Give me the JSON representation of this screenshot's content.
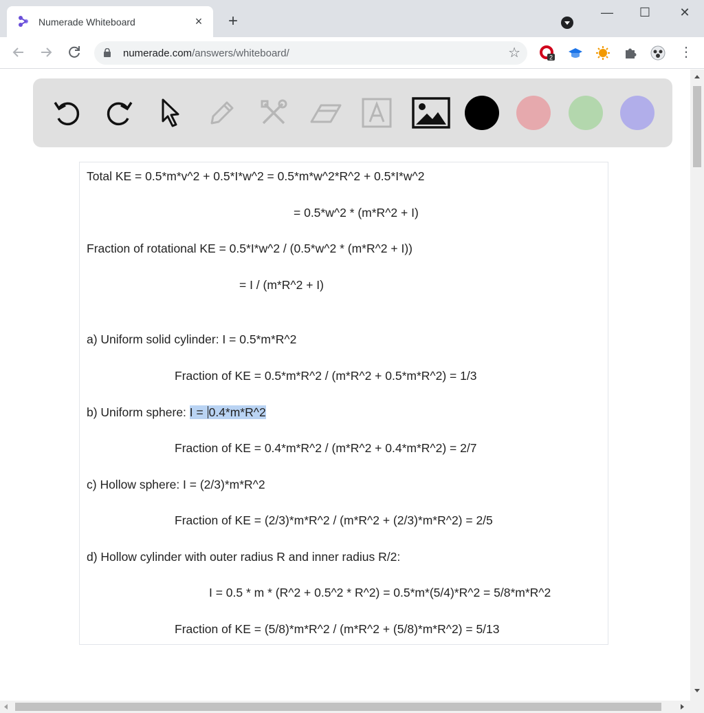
{
  "browser": {
    "tab_title": "Numerade Whiteboard",
    "tab_close": "×",
    "new_tab": "+",
    "url_domain": "numerade.com",
    "url_path": "/answers/whiteboard/",
    "ext_badge": "2",
    "window_minimize": "—",
    "window_maximize": "☐",
    "window_close": "✕"
  },
  "whiteboard_tools": [
    {
      "name": "undo-icon"
    },
    {
      "name": "redo-icon"
    },
    {
      "name": "pointer-icon"
    },
    {
      "name": "pen-icon"
    },
    {
      "name": "tools-icon"
    },
    {
      "name": "eraser-icon"
    },
    {
      "name": "text-tool-icon"
    },
    {
      "name": "image-icon"
    }
  ],
  "colors": {
    "black": "#000000",
    "pink": "#e6a9ad",
    "green": "#b3d7ad",
    "purple": "#b1aeea",
    "highlight": "#b9d3f3"
  },
  "document": {
    "line1": "Total KE = 0.5*m*v^2 + 0.5*I*w^2 = 0.5*m*w^2*R^2 + 0.5*I*w^2",
    "line2": "=  0.5*w^2 * (m*R^2 + I)",
    "line3": "Fraction of rotational KE = 0.5*I*w^2 / (0.5*w^2 * (m*R^2 + I))",
    "line4": "= I / (m*R^2 + I)",
    "a_label": "a)  Uniform solid cylinder:   I = 0.5*m*R^2",
    "a_fraction": "Fraction of KE = 0.5*m*R^2 / (m*R^2 + 0.5*m*R^2) = 1/3",
    "b_label": "b)  Uniform sphere:   ",
    "b_highlight_pre": "I = ",
    "b_highlight_post": "0.4*m*R^2",
    "b_fraction": "Fraction of KE = 0.4*m*R^2 / (m*R^2 + 0.4*m*R^2) = 2/7",
    "c_label": "c)  Hollow sphere:    I = (2/3)*m*R^2",
    "c_fraction": "Fraction of KE = (2/3)*m*R^2 / (m*R^2 + (2/3)*m*R^2) = 2/5",
    "d_label": "d) Hollow cylinder with outer radius R and inner radius R/2:",
    "d_inertia": "I = 0.5 * m * (R^2 + 0.5^2 * R^2) = 0.5*m*(5/4)*R^2 = 5/8*m*R^2",
    "d_fraction": "Fraction of KE = (5/8)*m*R^2 / (m*R^2 + (5/8)*m*R^2) = 5/13"
  }
}
